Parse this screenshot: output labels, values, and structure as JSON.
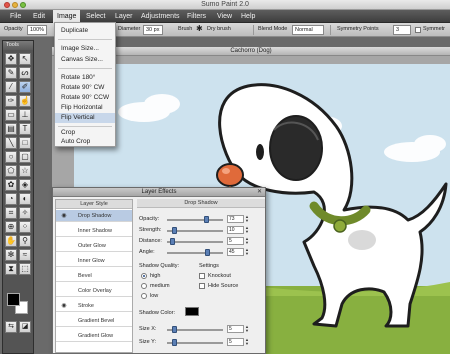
{
  "window": {
    "title": "Sumo Paint 2.0",
    "controls": [
      "close",
      "minimize",
      "zoom"
    ]
  },
  "menubar": {
    "items": [
      "File",
      "Edit",
      "Image",
      "Select",
      "Layer",
      "Adjustments",
      "Filters",
      "View",
      "Help"
    ],
    "active": "Image"
  },
  "options": {
    "opacity_label": "Opacity",
    "opacity_value": "100%",
    "diameter_label": "Diameter",
    "diameter_value": "30 px",
    "brush_label": "Brush",
    "brush_value": "Dry brush",
    "blend_label": "Blend Mode",
    "blend_value": "Normal",
    "symmetry_label": "Symmetry Points",
    "symmetry_value": "3",
    "symmetry_checkbox_label": "Symmetr"
  },
  "tools_panel": {
    "title": "Tools",
    "selected_tool": "brush-tool",
    "foreground_color": "#000000",
    "background_color": "#ffffff"
  },
  "image_menu": {
    "items": [
      {
        "label": "Duplicate"
      },
      {
        "label": "Image Size..."
      },
      {
        "label": "Canvas Size..."
      },
      {
        "label": "Rotate 180°"
      },
      {
        "label": "Rotate 90° CW"
      },
      {
        "label": "Rotate 90° CCW"
      },
      {
        "label": "Flip Horizontal"
      },
      {
        "label": "Flip Vertical",
        "highlighted": true
      },
      {
        "label": "Crop"
      },
      {
        "label": "Auto Crop"
      }
    ]
  },
  "canvas": {
    "title": "Cachorro (Dog)"
  },
  "layer_effects": {
    "title": "Layer Effects",
    "style_header": "Layer Style",
    "styles": [
      {
        "label": "Drop Shadow",
        "enabled": true,
        "selected": true
      },
      {
        "label": "Inner Shadow",
        "enabled": false
      },
      {
        "label": "Outer Glow",
        "enabled": false
      },
      {
        "label": "Inner Glow",
        "enabled": false
      },
      {
        "label": "Bevel",
        "enabled": false
      },
      {
        "label": "Color Overlay",
        "enabled": false
      },
      {
        "label": "Stroke",
        "enabled": true
      },
      {
        "label": "Gradient Bevel",
        "enabled": false
      },
      {
        "label": "Gradient Glow",
        "enabled": false
      }
    ],
    "panel_title": "Drop Shadow",
    "sliders": [
      {
        "label": "Opacity:",
        "value": "73",
        "fraction": 0.73
      },
      {
        "label": "Strength:",
        "value": "10",
        "fraction": 0.1
      },
      {
        "label": "Distance:",
        "value": "5",
        "fraction": 0.05
      },
      {
        "label": "Angle:",
        "value": "45",
        "fraction": 0.75
      }
    ],
    "quality_label": "Shadow Quality:",
    "quality_options": [
      "high",
      "medium",
      "low"
    ],
    "quality_selected": "high",
    "settings_label": "Settings",
    "settings_options": [
      "Knockout",
      "Hide Source"
    ],
    "shadow_color_label": "Shadow Color:",
    "shadow_color": "#000000",
    "size_sliders": [
      {
        "label": "Size X:",
        "value": "5",
        "fraction": 0.1
      },
      {
        "label": "Size Y:",
        "value": "5",
        "fraction": 0.1
      }
    ]
  },
  "colors": {
    "sky": "#cfe3ee",
    "cloud": "#ffffff",
    "grass": "#7fa83a",
    "dog_nose": "#e06a3a",
    "collar": "#6f8a2a",
    "selection": "#b9cbe3"
  }
}
